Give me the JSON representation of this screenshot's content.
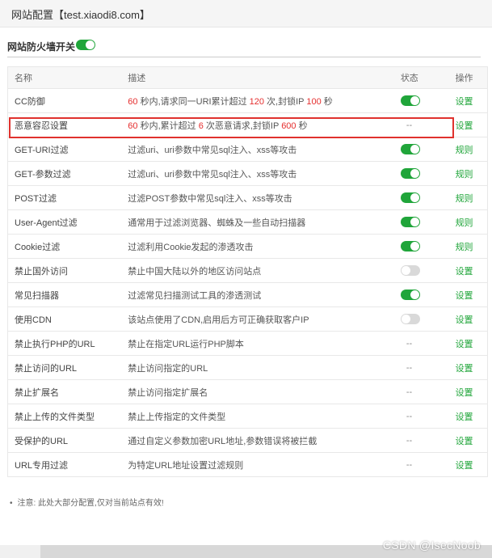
{
  "window": {
    "title": "网站配置【test.xiaodi8.com】"
  },
  "firewall": {
    "label": "网站防火墙开关",
    "enabled": true
  },
  "table": {
    "headers": [
      "名称",
      "描述",
      "状态",
      "操作"
    ],
    "rows": [
      {
        "name": "CC防御",
        "desc": [
          {
            "t": "60",
            "num": true
          },
          {
            "t": " 秒内,请求同一URI累计超过 "
          },
          {
            "t": "120",
            "num": true
          },
          {
            "t": " 次,封锁IP "
          },
          {
            "t": "100",
            "num": true
          },
          {
            "t": " 秒"
          }
        ],
        "status": "on",
        "action": "设置"
      },
      {
        "name": "恶意容忍设置",
        "desc": [
          {
            "t": "60",
            "num": true
          },
          {
            "t": " 秒内,累计超过 "
          },
          {
            "t": "6",
            "num": true
          },
          {
            "t": " 次恶意请求,封锁IP "
          },
          {
            "t": "600",
            "num": true
          },
          {
            "t": " 秒"
          }
        ],
        "status": "--",
        "action": "设置"
      },
      {
        "name": "GET-URI过滤",
        "desc": [
          {
            "t": "过滤uri、uri参数中常见sql注入、xss等攻击"
          }
        ],
        "status": "on",
        "action": "规则"
      },
      {
        "name": "GET-参数过滤",
        "desc": [
          {
            "t": "过滤uri、uri参数中常见sql注入、xss等攻击"
          }
        ],
        "status": "on",
        "action": "规则"
      },
      {
        "name": "POST过滤",
        "desc": [
          {
            "t": "过滤POST参数中常见sql注入、xss等攻击"
          }
        ],
        "status": "on",
        "action": "规则"
      },
      {
        "name": "User-Agent过滤",
        "desc": [
          {
            "t": "通常用于过滤浏览器、蜘蛛及一些自动扫描器"
          }
        ],
        "status": "on",
        "action": "规则"
      },
      {
        "name": "Cookie过滤",
        "desc": [
          {
            "t": "过滤利用Cookie发起的渗透攻击"
          }
        ],
        "status": "on",
        "action": "规则"
      },
      {
        "name": "禁止国外访问",
        "desc": [
          {
            "t": "禁止中国大陆以外的地区访问站点"
          }
        ],
        "status": "off",
        "action": "设置"
      },
      {
        "name": "常见扫描器",
        "desc": [
          {
            "t": "过滤常见扫描测试工具的渗透测试"
          }
        ],
        "status": "on",
        "action": "设置"
      },
      {
        "name": "使用CDN",
        "desc": [
          {
            "t": "该站点使用了CDN,启用后方可正确获取客户IP"
          }
        ],
        "status": "off",
        "action": "设置"
      },
      {
        "name": "禁止执行PHP的URL",
        "desc": [
          {
            "t": "禁止在指定URL运行PHP脚本"
          }
        ],
        "status": "--",
        "action": "设置"
      },
      {
        "name": "禁止访问的URL",
        "desc": [
          {
            "t": "禁止访问指定的URL"
          }
        ],
        "status": "--",
        "action": "设置"
      },
      {
        "name": "禁止扩展名",
        "desc": [
          {
            "t": "禁止访问指定扩展名"
          }
        ],
        "status": "--",
        "action": "设置"
      },
      {
        "name": "禁止上传的文件类型",
        "desc": [
          {
            "t": "禁止上传指定的文件类型"
          }
        ],
        "status": "--",
        "action": "设置"
      },
      {
        "name": "受保护的URL",
        "desc": [
          {
            "t": "通过自定义参数加密URL地址,参数错误将被拦截"
          }
        ],
        "status": "--",
        "action": "设置"
      },
      {
        "name": "URL专用过滤",
        "desc": [
          {
            "t": "为特定URL地址设置过滤规则"
          }
        ],
        "status": "--",
        "action": "设置"
      }
    ]
  },
  "note": {
    "bullet": "•",
    "text": "注意: 此处大部分配置,仅对当前站点有效!"
  },
  "watermark": "CSDN @IsecNoob",
  "colors": {
    "accent": "#20a53a",
    "number": "#e52e2e",
    "highlight": "#e0322e"
  }
}
